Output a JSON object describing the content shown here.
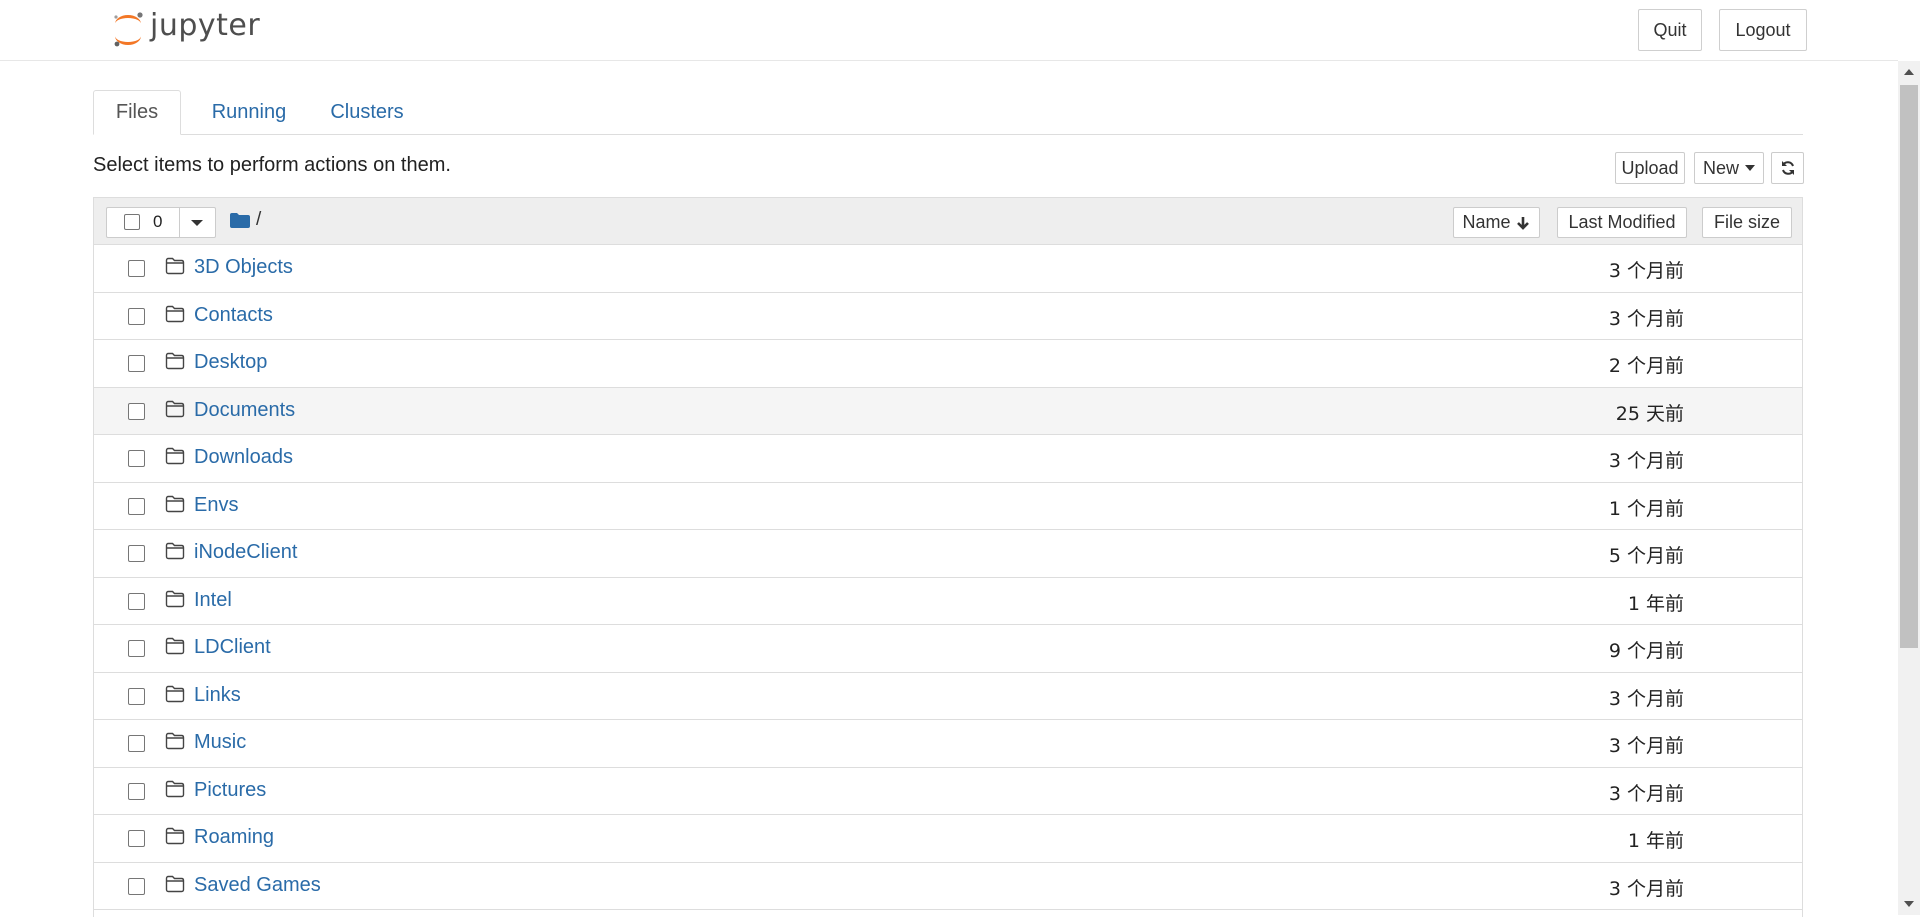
{
  "app": {
    "logo_text": "jupyter",
    "quit_label": "Quit",
    "logout_label": "Logout"
  },
  "tabs": [
    {
      "label": "Files",
      "active": true
    },
    {
      "label": "Running",
      "active": false
    },
    {
      "label": "Clusters",
      "active": false
    }
  ],
  "toolbar": {
    "hint": "Select items to perform actions on them.",
    "upload_label": "Upload",
    "new_label": "New",
    "refresh_icon": "refresh-icon"
  },
  "list_header": {
    "selected_count": "0",
    "path": "/",
    "col_name": "Name",
    "col_modified": "Last Modified",
    "col_size": "File size"
  },
  "items": [
    {
      "name": "3D Objects",
      "modified": "3 个月前"
    },
    {
      "name": "Contacts",
      "modified": "3 个月前"
    },
    {
      "name": "Desktop",
      "modified": "2 个月前"
    },
    {
      "name": "Documents",
      "modified": "25 天前"
    },
    {
      "name": "Downloads",
      "modified": "3 个月前"
    },
    {
      "name": "Envs",
      "modified": "1 个月前"
    },
    {
      "name": "iNodeClient",
      "modified": "5 个月前"
    },
    {
      "name": "Intel",
      "modified": "1 年前"
    },
    {
      "name": "LDClient",
      "modified": "9 个月前"
    },
    {
      "name": "Links",
      "modified": "3 个月前"
    },
    {
      "name": "Music",
      "modified": "3 个月前"
    },
    {
      "name": "Pictures",
      "modified": "3 个月前"
    },
    {
      "name": "Roaming",
      "modified": "1 年前"
    },
    {
      "name": "Saved Games",
      "modified": "3 个月前"
    }
  ],
  "colors": {
    "link": "#2a6ba8",
    "logo_orange": "#f37726",
    "header_bg": "#eeeeee"
  }
}
